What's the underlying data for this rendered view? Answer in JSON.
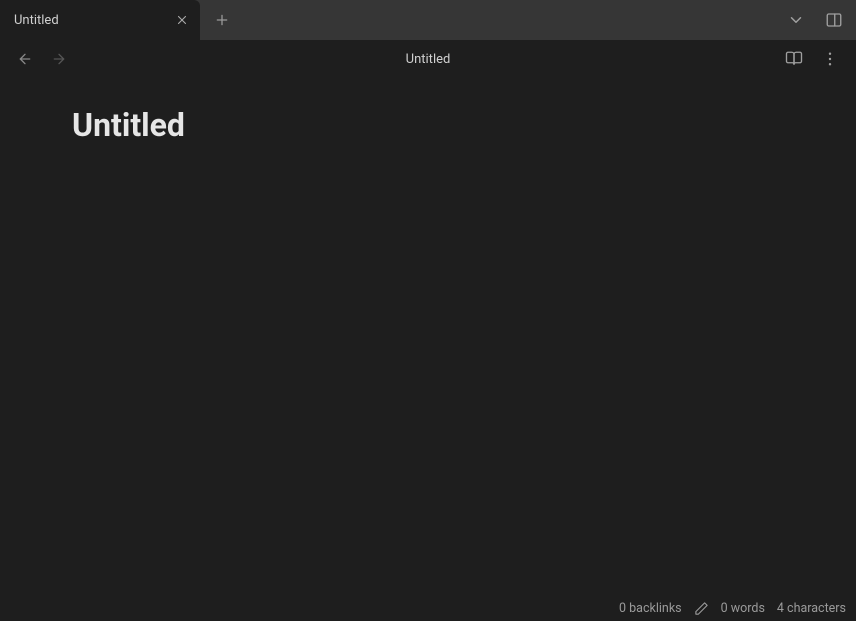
{
  "tabs": [
    {
      "title": "Untitled"
    }
  ],
  "header": {
    "title": "Untitled"
  },
  "document": {
    "title": "Untitled"
  },
  "statusbar": {
    "backlinks": "0 backlinks",
    "words": "0 words",
    "characters": "4 characters"
  }
}
